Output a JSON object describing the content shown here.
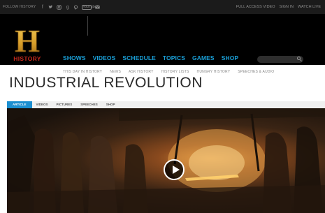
{
  "topbar": {
    "follow_label": "FOLLOW HISTORY",
    "social_icons": [
      "facebook-icon",
      "twitter-icon",
      "instagram-icon",
      "google-plus-icon",
      "pinterest-icon",
      "youtube-icon",
      "email-icon"
    ],
    "youtube_label": "YouTube",
    "links": [
      "FULL ACCESS VIDEO",
      "SIGN IN",
      "WATCH LIVE"
    ]
  },
  "header": {
    "logo_letter": "H",
    "logo_text": "HISTORY",
    "nav": [
      "SHOWS",
      "VIDEOS",
      "SCHEDULE",
      "TOPICS",
      "GAMES",
      "SHOP"
    ],
    "subnav": [
      "THIS DAY IN HISTORY",
      "NEWS",
      "ASK HISTORY",
      "HISTORY LISTS",
      "HUNGRY HISTORY",
      "SPEECHES & AUDIO"
    ],
    "search_placeholder": ""
  },
  "page": {
    "title": "INDUSTRIAL REVOLUTION",
    "tabs": [
      "ARTICLE",
      "VIDEOS",
      "PICTURES",
      "SPEECHES",
      "SHOP"
    ],
    "active_tab": "ARTICLE"
  },
  "colors": {
    "accent": "#1aa0d8",
    "logo_gold": "#d9a02c",
    "logo_red": "#c62a1e",
    "tab_active": "#1c8fd1"
  }
}
